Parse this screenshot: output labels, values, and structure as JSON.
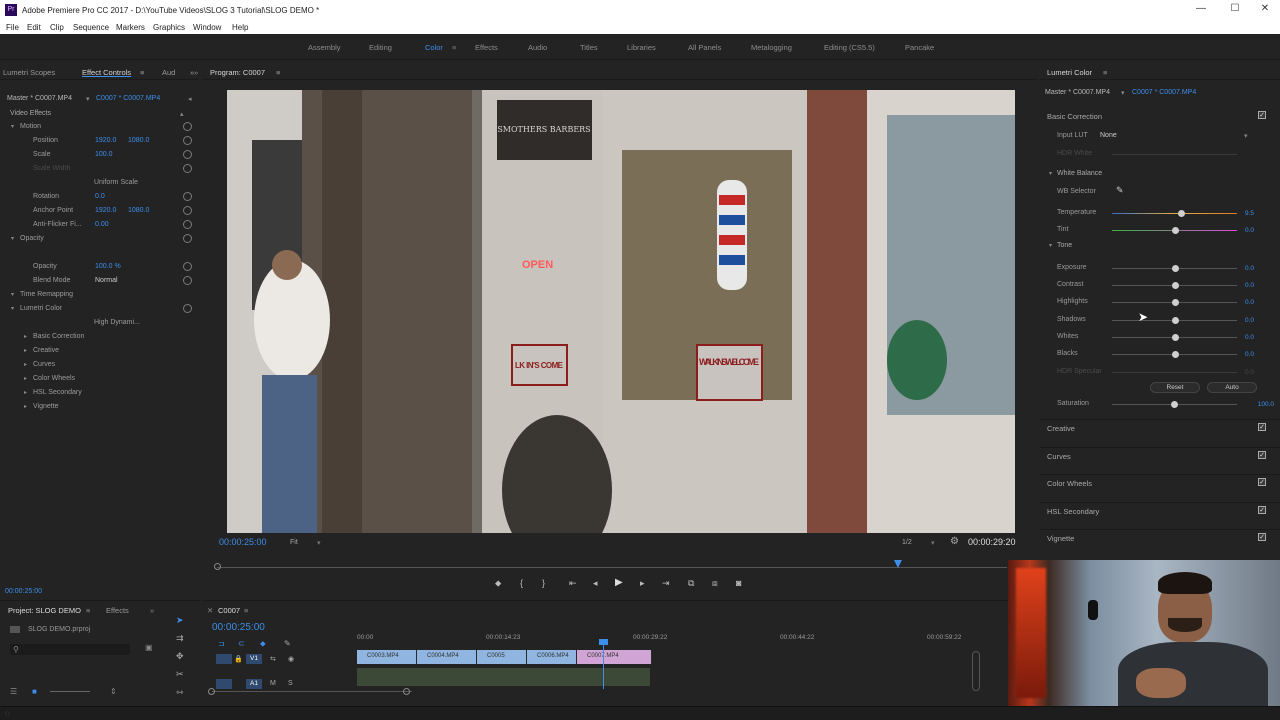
{
  "app": {
    "title": "Adobe Premiere Pro CC 2017 - D:\\YouTube Videos\\SLOG 3 Tutorial\\SLOG DEMO *",
    "logo": "Pr",
    "menu": [
      "File",
      "Edit",
      "Clip",
      "Sequence",
      "Markers",
      "Graphics",
      "Window",
      "Help"
    ],
    "window_controls": [
      "—",
      "☐",
      "✕"
    ]
  },
  "workspaces": {
    "items": [
      "Assembly",
      "Editing",
      "Color",
      "Effects",
      "Audio",
      "Titles",
      "Libraries",
      "All Panels",
      "Metalogging",
      "Editing (CS5.5)",
      "Pancake"
    ],
    "active": "Color"
  },
  "effect_controls": {
    "tabs": [
      "Lumetri Scopes",
      "Effect Controls",
      "Aud"
    ],
    "active_tab": "Effect Controls",
    "source": "Master * C0007.MP4",
    "clip": "C0007 * C0007.MP4",
    "section": "Video Effects",
    "rows": [
      {
        "label": "Motion",
        "indent": 1
      },
      {
        "label": "Position",
        "indent": 2,
        "v1": "1920.0",
        "v2": "1080.0"
      },
      {
        "label": "Scale",
        "indent": 2,
        "v1": "100.0",
        "v2": ""
      },
      {
        "label": "Scale Width",
        "indent": 2,
        "v1": "",
        "v2": ""
      },
      {
        "label": "Uniform Scale",
        "indent": 3,
        "v1": "",
        "v2": ""
      },
      {
        "label": "Rotation",
        "indent": 2,
        "v1": "0.0",
        "v2": ""
      },
      {
        "label": "Anchor Point",
        "indent": 2,
        "v1": "1920.0",
        "v2": "1080.0"
      },
      {
        "label": "Anti-Flicker Fi...",
        "indent": 2,
        "v1": "0.00",
        "v2": ""
      },
      {
        "label": "Opacity",
        "indent": 1,
        "v1": "",
        "v2": ""
      },
      {
        "label": "",
        "indent": 2,
        "v1": "",
        "v2": ""
      },
      {
        "label": "Opacity",
        "indent": 2,
        "v1": "100.0 %",
        "v2": ""
      },
      {
        "label": "Blend Mode",
        "indent": 2,
        "v1": "Normal",
        "v2": ""
      },
      {
        "label": "Time Remapping",
        "indent": 1,
        "v1": "",
        "v2": ""
      },
      {
        "label": "Lumetri Color",
        "indent": 1,
        "v1": "",
        "v2": ""
      },
      {
        "label": "High Dynami...",
        "indent": 3,
        "v1": "",
        "v2": ""
      },
      {
        "label": "Basic Correction",
        "indent": 2,
        "v1": "",
        "v2": ""
      },
      {
        "label": "Creative",
        "indent": 2,
        "v1": "",
        "v2": ""
      },
      {
        "label": "Curves",
        "indent": 2,
        "v1": "",
        "v2": ""
      },
      {
        "label": "Color Wheels",
        "indent": 2,
        "v1": "",
        "v2": ""
      },
      {
        "label": "HSL Secondary",
        "indent": 2,
        "v1": "",
        "v2": ""
      },
      {
        "label": "Vignette",
        "indent": 2,
        "v1": "",
        "v2": ""
      }
    ],
    "footer_time": "00:00:25:00"
  },
  "program": {
    "title": "Program: C0007",
    "timecode": "00:00:25:00",
    "fit": "Fit",
    "resolution": "1/2",
    "duration": "00:00:29:20",
    "playhead_fraction": 0.862,
    "scene_text": {
      "sign": "SMOTHERS BARBERS",
      "open": "OPEN",
      "walk1": "WALK IN'S WELCOME",
      "walk2": "LK IN'S COME"
    }
  },
  "lumetri": {
    "title": "Lumetri Color",
    "source": "Master * C0007.MP4",
    "clip": "C0007 * C0007.MP4",
    "basic_correction": "Basic Correction",
    "input_lut_label": "Input LUT",
    "input_lut_value": "None",
    "hdr_white": "HDR White",
    "white_balance": "White Balance",
    "wb_selector": "WB Selector",
    "tone": "Tone",
    "sliders": [
      {
        "label": "Temperature",
        "value": "9.5",
        "pos": 0.55
      },
      {
        "label": "Tint",
        "value": "0.0",
        "pos": 0.5
      },
      {
        "label": "Exposure",
        "value": "0.0",
        "pos": 0.5
      },
      {
        "label": "Contrast",
        "value": "0.0",
        "pos": 0.5
      },
      {
        "label": "Highlights",
        "value": "0.0",
        "pos": 0.5
      },
      {
        "label": "Shadows",
        "value": "0.0",
        "pos": 0.5
      },
      {
        "label": "Whites",
        "value": "0.0",
        "pos": 0.5
      },
      {
        "label": "Blacks",
        "value": "0.0",
        "pos": 0.5
      },
      {
        "label": "HDR Specular",
        "value": "0.0",
        "pos": 0.5
      }
    ],
    "reset": "Reset",
    "auto": "Auto",
    "saturation_label": "Saturation",
    "saturation_value": "100.0",
    "sections": [
      "Creative",
      "Curves",
      "Color Wheels",
      "HSL Secondary",
      "Vignette"
    ],
    "check": "✓"
  },
  "project": {
    "tabs": [
      "Project: SLOG DEMO",
      "Effects"
    ],
    "file": "SLOG DEMO.prproj"
  },
  "timeline": {
    "title": "C0007",
    "timecode": "00:00:25:00",
    "ruler": [
      "00:00",
      "00:00:14:23",
      "00:00:29:22",
      "00:00:44:22",
      "00:00:59:22"
    ],
    "tracks": [
      "V1",
      "A1"
    ],
    "clips": [
      "C0003.MP4",
      "C0004.MP4",
      "C0005",
      "C0006.MP4",
      "C0007.MP4"
    ]
  },
  "colors": {
    "accent": "#3d8eea",
    "panel": "#232323",
    "clip": "#8fb5e0",
    "clip_selected": "#d0a5d5"
  }
}
